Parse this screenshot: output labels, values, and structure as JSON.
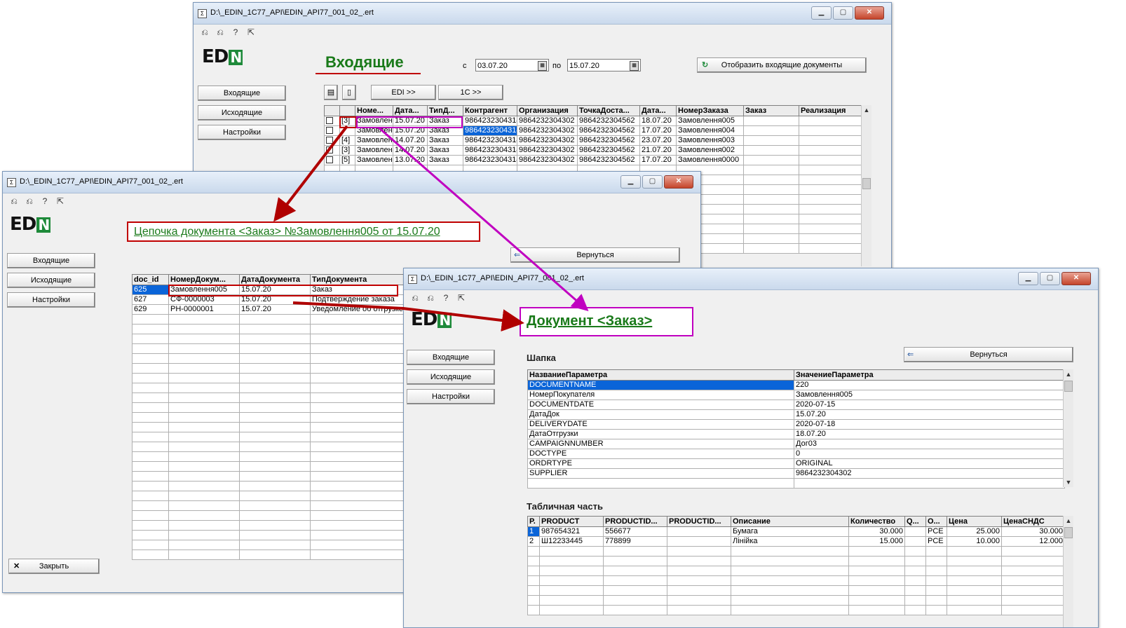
{
  "window1": {
    "title": "D:\\_EDIN_1C77_API\\EDIN_API77_001_02_.ert",
    "logo": "ED",
    "logo_n": "N",
    "heading": "Входящие",
    "date_from_label": "с",
    "date_from": "03.07.20",
    "date_to_label": "по",
    "date_to": "15.07.20",
    "show_button": "Отобразить входящие документы",
    "nav": [
      "Входящие",
      "Исходящие",
      "Настройки"
    ],
    "edi_button": "EDI >>",
    "onec_button": "1С >>",
    "columns": [
      "",
      "",
      "Номе...",
      "Дата...",
      "ТипД...",
      "Контрагент",
      "Организация",
      "ТочкаДоста...",
      "Дата...",
      "НомерЗаказа",
      "Заказ",
      "Реализация"
    ],
    "rows": [
      {
        "count": "[3]",
        "num": "Замовлен",
        "date": "15.07.20",
        "type": "Заказ",
        "contragent": "9864232304314",
        "org": "9864232304302",
        "point": "9864232304562",
        "date2": "18.07.20",
        "order": "Замовлення005"
      },
      {
        "count": "",
        "num": "Замовлен",
        "date": "15.07.20",
        "type": "Заказ",
        "contragent": "9864232304314",
        "org": "9864232304302",
        "point": "9864232304562",
        "date2": "17.07.20",
        "order": "Замовлення004"
      },
      {
        "count": "[4]",
        "num": "Замовлен",
        "date": "14.07.20",
        "type": "Заказ",
        "contragent": "9864232304314",
        "org": "9864232304302",
        "point": "9864232304562",
        "date2": "23.07.20",
        "order": "Замовлення003"
      },
      {
        "count": "[3]",
        "num": "Замовлен",
        "date": "14.07.20",
        "type": "Заказ",
        "contragent": "9864232304314",
        "org": "9864232304302",
        "point": "9864232304562",
        "date2": "21.07.20",
        "order": "Замовлення002"
      },
      {
        "count": "[5]",
        "num": "Замовлен",
        "date": "13.07.20",
        "type": "Заказ",
        "contragent": "9864232304314",
        "org": "9864232304302",
        "point": "9864232304562",
        "date2": "17.07.20",
        "order": "Замовлення0000"
      }
    ]
  },
  "window2": {
    "title": "D:\\_EDIN_1C77_API\\EDIN_API77_001_02_.ert",
    "heading": "Цепочка документа <Заказ> №Замовлення005 от 15.07.20",
    "back_button": "Вернуться",
    "nav": [
      "Входящие",
      "Исходящие",
      "Настройки"
    ],
    "close_button": "Закрыть",
    "columns": [
      "doc_id",
      "НомерДокум...",
      "ДатаДокумента",
      "ТипДокумента"
    ],
    "rows": [
      {
        "id": "625",
        "num": "Замовлення005",
        "date": "15.07.20",
        "type": "Заказ"
      },
      {
        "id": "627",
        "num": "СФ-0000003",
        "date": "15.07.20",
        "type": "Подтверждение заказа"
      },
      {
        "id": "629",
        "num": "РН-0000001",
        "date": "15.07.20",
        "type": "Уведомление об отгрузке"
      }
    ]
  },
  "window3": {
    "title": "D:\\_EDIN_1C77_API\\EDIN_API77_001_02_.ert",
    "heading": "Документ <Заказ>",
    "back_button": "Вернуться",
    "nav": [
      "Входящие",
      "Исходящие",
      "Настройки"
    ],
    "header_section": "Шапка",
    "header_columns": [
      "НазваниеПараметра",
      "ЗначениеПараметра"
    ],
    "header_rows": [
      {
        "name": "DOCUMENTNAME",
        "value": "220"
      },
      {
        "name": "НомерПокупателя",
        "value": "Замовлення005"
      },
      {
        "name": "DOCUMENTDATE",
        "value": "2020-07-15"
      },
      {
        "name": "ДатаДок",
        "value": "15.07.20"
      },
      {
        "name": "DELIVERYDATE",
        "value": "2020-07-18"
      },
      {
        "name": "ДатаОтгрузки",
        "value": "18.07.20"
      },
      {
        "name": "CAMPAIGNNUMBER",
        "value": "Дог03"
      },
      {
        "name": "DOCTYPE",
        "value": "0"
      },
      {
        "name": "ORDRTYPE",
        "value": "ORIGINAL"
      },
      {
        "name": "SUPPLIER",
        "value": "9864232304302"
      }
    ],
    "table_section": "Табличная часть",
    "table_columns": [
      "Р.",
      "PRODUCT",
      "PRODUCTID...",
      "PRODUCTID...",
      "Описание",
      "Количество",
      "Q...",
      "О...",
      "Цена",
      "ЦенаСНДС"
    ],
    "table_rows": [
      {
        "n": "1",
        "product": "987654321",
        "pid1": "556677",
        "pid2": "",
        "desc": "Бумага",
        "qty": "30.000",
        "q": "",
        "o": "PCE",
        "price": "25.000",
        "price_vat": "30.000"
      },
      {
        "n": "2",
        "product": "Ш12233445",
        "pid1": "778899",
        "pid2": "",
        "desc": "Лінійка",
        "qty": "15.000",
        "q": "",
        "o": "PCE",
        "price": "10.000",
        "price_vat": "12.000"
      }
    ]
  },
  "colors": {
    "arrow_red": "#b00000",
    "arrow_magenta": "#c000c0",
    "title_green": "#1a7a1a",
    "selection": "#0a64d8"
  }
}
